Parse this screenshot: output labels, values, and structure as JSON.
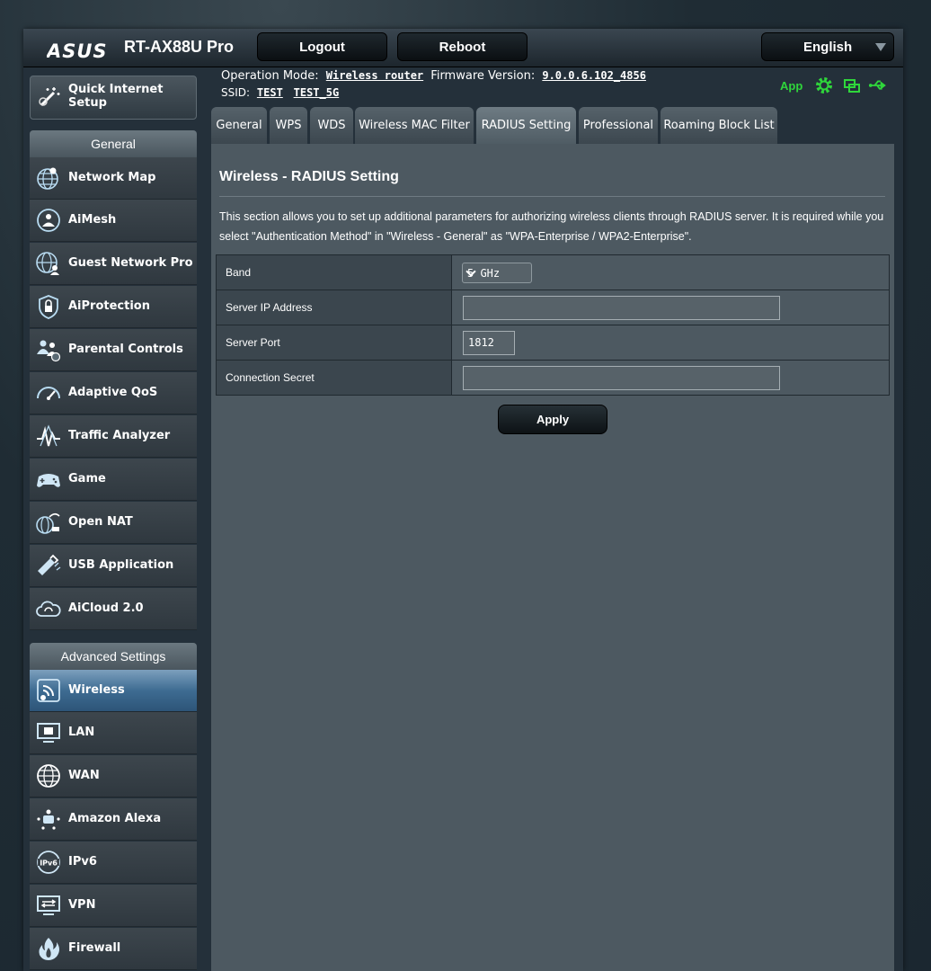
{
  "header": {
    "logo": "/ISUS",
    "model": "RT-AX88U Pro",
    "logout_label": "Logout",
    "reboot_label": "Reboot",
    "language": "English"
  },
  "status": {
    "operation_mode_label": "Operation Mode:",
    "operation_mode_value": "Wireless router",
    "firmware_label": "Firmware Version:",
    "firmware_value": "9.0.0.6.102_4856",
    "ssid_label": "SSID:",
    "ssid_1": "TEST",
    "ssid_2": "TEST_5G",
    "app_label": "App"
  },
  "sidebar": {
    "qis_label_line1": "Quick Internet",
    "qis_label_line2": "Setup",
    "general_header": "General",
    "general_items": [
      {
        "label": "Network Map",
        "icon": "globe-network-icon"
      },
      {
        "label": "AiMesh",
        "icon": "aimesh-icon"
      },
      {
        "label": "Guest Network Pro",
        "icon": "guest-network-icon"
      },
      {
        "label": "AiProtection",
        "icon": "shield-lock-icon"
      },
      {
        "label": "Parental Controls",
        "icon": "family-icon"
      },
      {
        "label": "Adaptive QoS",
        "icon": "speedometer-icon"
      },
      {
        "label": "Traffic Analyzer",
        "icon": "pulse-icon"
      },
      {
        "label": "Game",
        "icon": "gamepad-icon"
      },
      {
        "label": "Open NAT",
        "icon": "open-nat-icon"
      },
      {
        "label": "USB Application",
        "icon": "usb-drive-icon"
      },
      {
        "label": "AiCloud 2.0",
        "icon": "cloud-icon"
      }
    ],
    "advanced_header": "Advanced Settings",
    "advanced_items": [
      {
        "label": "Wireless",
        "icon": "wifi-icon",
        "active": true
      },
      {
        "label": "LAN",
        "icon": "lan-icon"
      },
      {
        "label": "WAN",
        "icon": "wan-globe-icon"
      },
      {
        "label": "Amazon Alexa",
        "icon": "alexa-icon"
      },
      {
        "label": "IPv6",
        "icon": "ipv6-icon"
      },
      {
        "label": "VPN",
        "icon": "vpn-icon"
      },
      {
        "label": "Firewall",
        "icon": "firewall-icon"
      }
    ]
  },
  "tabs": [
    {
      "label": "General"
    },
    {
      "label": "WPS"
    },
    {
      "label": "WDS"
    },
    {
      "label": "Wireless MAC Filter"
    },
    {
      "label": "RADIUS Setting",
      "active": true
    },
    {
      "label": "Professional"
    },
    {
      "label": "Roaming Block List"
    }
  ],
  "main": {
    "title": "Wireless - RADIUS Setting",
    "description": "This section allows you to set up additional parameters for authorizing wireless clients through RADIUS server. It is required while you select \"Authentication Method\" in \"Wireless - General\" as \"WPA-Enterprise / WPA2-Enterprise\".",
    "band_label": "Band",
    "band_value": "5 GHz",
    "server_ip_label": "Server IP Address",
    "server_ip_value": "",
    "server_port_label": "Server Port",
    "server_port_value": "1812",
    "secret_label": "Connection Secret",
    "secret_value": "",
    "apply_label": "Apply"
  },
  "colors": {
    "accent_green": "#2fd63b",
    "active_blue": "#3e6c92",
    "content_bg": "#4d5961"
  }
}
